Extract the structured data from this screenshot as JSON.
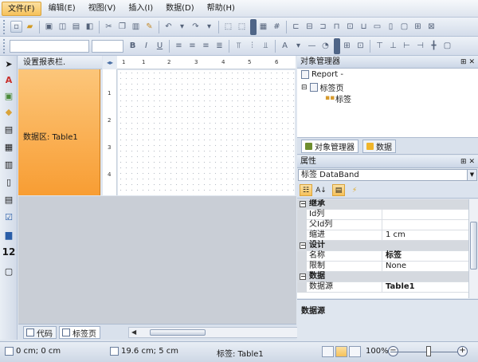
{
  "menu": [
    "文件(F)",
    "编辑(E)",
    "视图(V)",
    "插入(I)",
    "数据(D)",
    "帮助(H)"
  ],
  "band_panel": {
    "title": "设置报表栏.",
    "band_label": "数据区: Table1"
  },
  "ruler": {
    "top": [
      "1",
      "1",
      "2",
      "3",
      "4",
      "5",
      "6"
    ],
    "left": [
      "1",
      "2",
      "3",
      "4"
    ]
  },
  "bottom_tabs": [
    "代码",
    "标签页"
  ],
  "object_manager": {
    "title": "对象管理器",
    "tree": [
      "Report -",
      "标签页",
      "标签"
    ],
    "tabs": [
      "对象管理器",
      "数据"
    ]
  },
  "properties": {
    "title": "属性",
    "selected": "标签 DataBand",
    "rows": [
      {
        "type": "cat",
        "label": "继承"
      },
      {
        "type": "prop",
        "name": "Id列",
        "value": ""
      },
      {
        "type": "prop",
        "name": "父Id列",
        "value": ""
      },
      {
        "type": "prop",
        "name": "缩进",
        "value": "1 cm"
      },
      {
        "type": "cat",
        "label": "设计"
      },
      {
        "type": "prop",
        "name": "名称",
        "value": "标签",
        "bold": true
      },
      {
        "type": "prop",
        "name": "限制",
        "value": "None"
      },
      {
        "type": "cat",
        "label": "数据"
      },
      {
        "type": "prop",
        "name": "数据源",
        "value": "Table1",
        "bold": true
      }
    ],
    "description": "数据源"
  },
  "status": {
    "position": "0 cm; 0 cm",
    "size": "19.6 cm; 5 cm",
    "object": "标签:  Table1",
    "zoom": "100%"
  },
  "colors": {
    "band": "#f89d33",
    "accent": "#f6c15a"
  }
}
